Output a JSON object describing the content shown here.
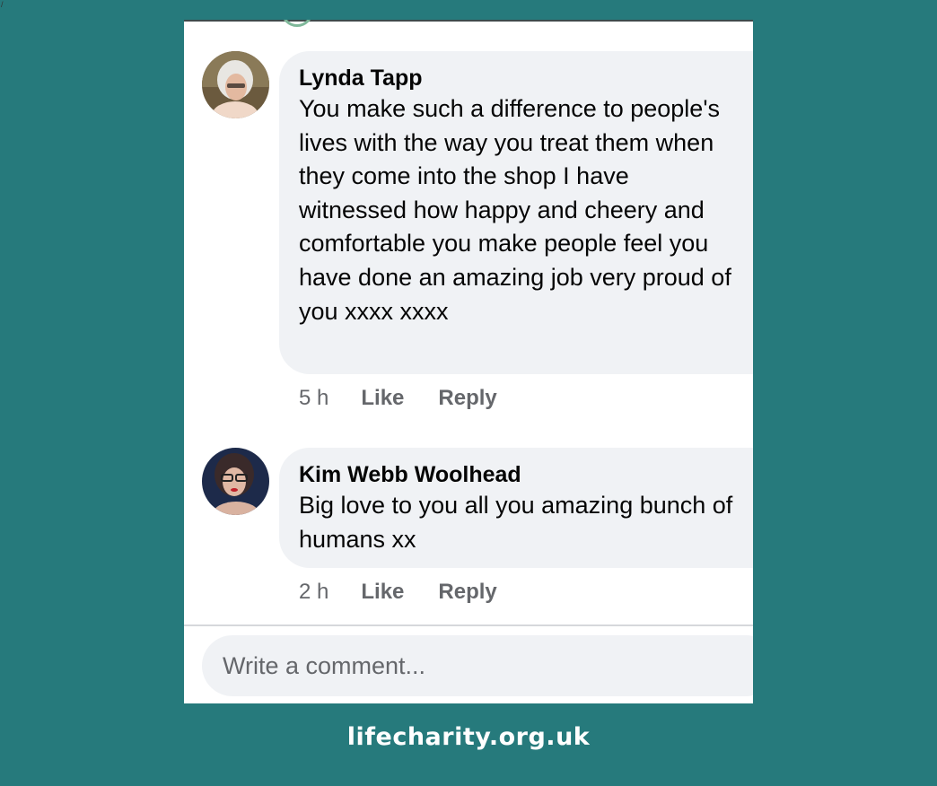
{
  "colors": {
    "background": "#267a7c",
    "bubble": "#f0f2f5",
    "muted": "#65676b"
  },
  "comments": [
    {
      "author": "Lynda Tapp",
      "text": "You make such a difference to people's lives with the way you treat them when they come into the shop I have witnessed how happy and cheery and comfortable you make people feel you have done an amazing job very proud of you xxxx xxxx",
      "time": "5 h",
      "like_label": "Like",
      "reply_label": "Reply"
    },
    {
      "author": "Kim Webb Woolhead",
      "text": "Big love to you all you amazing bunch of humans xx",
      "time": "2 h",
      "like_label": "Like",
      "reply_label": "Reply"
    }
  ],
  "composer": {
    "placeholder": "Write a comment..."
  },
  "footer": {
    "url": "lifecharity.org.uk"
  }
}
